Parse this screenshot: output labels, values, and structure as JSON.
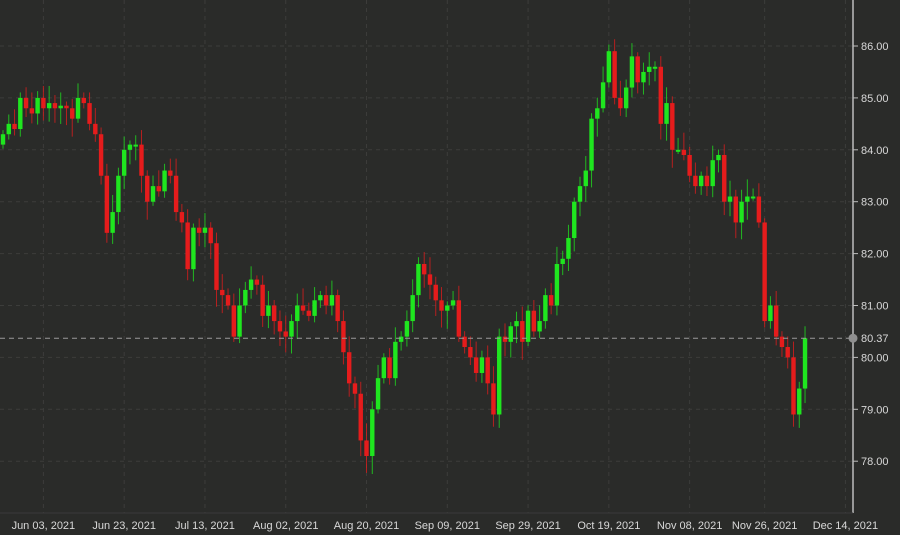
{
  "chart_data": {
    "type": "candlestick",
    "title": "",
    "xlabel": "",
    "ylabel": "",
    "ylim": [
      77.0,
      86.9
    ],
    "y_ticks": [
      "86.00",
      "85.00",
      "84.00",
      "83.00",
      "82.00",
      "81.00",
      "80.00",
      "79.00",
      "78.00"
    ],
    "y_tick_values": [
      86,
      85,
      84,
      83,
      82,
      81,
      80,
      79,
      78
    ],
    "x_ticks": [
      {
        "label": "Jun 03, 2021",
        "index": 7
      },
      {
        "label": "Jun 23, 2021",
        "index": 21
      },
      {
        "label": "Jul 13, 2021",
        "index": 35
      },
      {
        "label": "Aug 02, 2021",
        "index": 49
      },
      {
        "label": "Aug 20, 2021",
        "index": 63
      },
      {
        "label": "Sep 09, 2021",
        "index": 77
      },
      {
        "label": "Sep 29, 2021",
        "index": 91
      },
      {
        "label": "Oct 19, 2021",
        "index": 105
      },
      {
        "label": "Nov 08, 2021",
        "index": 119
      },
      {
        "label": "Nov 26, 2021",
        "index": 132
      },
      {
        "label": "Dec 14, 2021",
        "index": 146
      }
    ],
    "first_open": 84.1,
    "closes": [
      84.3,
      84.5,
      84.4,
      85.0,
      84.8,
      84.7,
      85.0,
      84.8,
      84.9,
      84.8,
      84.85,
      84.8,
      84.6,
      85.0,
      84.9,
      84.5,
      84.3,
      83.5,
      82.4,
      82.8,
      83.5,
      84.0,
      84.1,
      84.1,
      83.5,
      83.0,
      83.3,
      83.2,
      83.6,
      83.5,
      82.8,
      82.6,
      81.7,
      82.5,
      82.4,
      82.5,
      82.2,
      81.3,
      81.2,
      81.0,
      80.4,
      81.0,
      81.3,
      81.5,
      81.4,
      80.8,
      81.0,
      80.7,
      80.5,
      80.4,
      80.7,
      81.0,
      80.9,
      80.8,
      81.1,
      81.2,
      81.0,
      81.2,
      80.7,
      80.1,
      79.5,
      79.3,
      78.4,
      78.1,
      79.0,
      79.6,
      80.0,
      79.6,
      80.3,
      80.4,
      80.7,
      81.2,
      81.8,
      81.6,
      81.4,
      81.1,
      80.9,
      81.0,
      81.1,
      80.4,
      80.2,
      80.0,
      79.7,
      80.0,
      79.5,
      78.9,
      80.4,
      80.3,
      80.6,
      80.7,
      80.3,
      80.9,
      80.5,
      80.7,
      81.2,
      81.0,
      81.8,
      81.9,
      82.3,
      83.0,
      83.3,
      83.6,
      84.6,
      84.8,
      85.3,
      85.9,
      85.0,
      84.8,
      85.2,
      85.8,
      85.3,
      85.5,
      85.6,
      85.6,
      84.5,
      84.9,
      84.0,
      84.0,
      83.9,
      83.5,
      83.3,
      83.5,
      83.3,
      83.8,
      83.9,
      83.0,
      83.1,
      82.6,
      83.0,
      83.1,
      83.1,
      82.6,
      80.7,
      81.0,
      80.4,
      80.2,
      80.0,
      78.9,
      79.4,
      80.37
    ],
    "last_price": 80.37,
    "last_price_label": "80.37",
    "up_color": "#1fe61f",
    "down_color": "#e51c1c",
    "grid": true
  }
}
